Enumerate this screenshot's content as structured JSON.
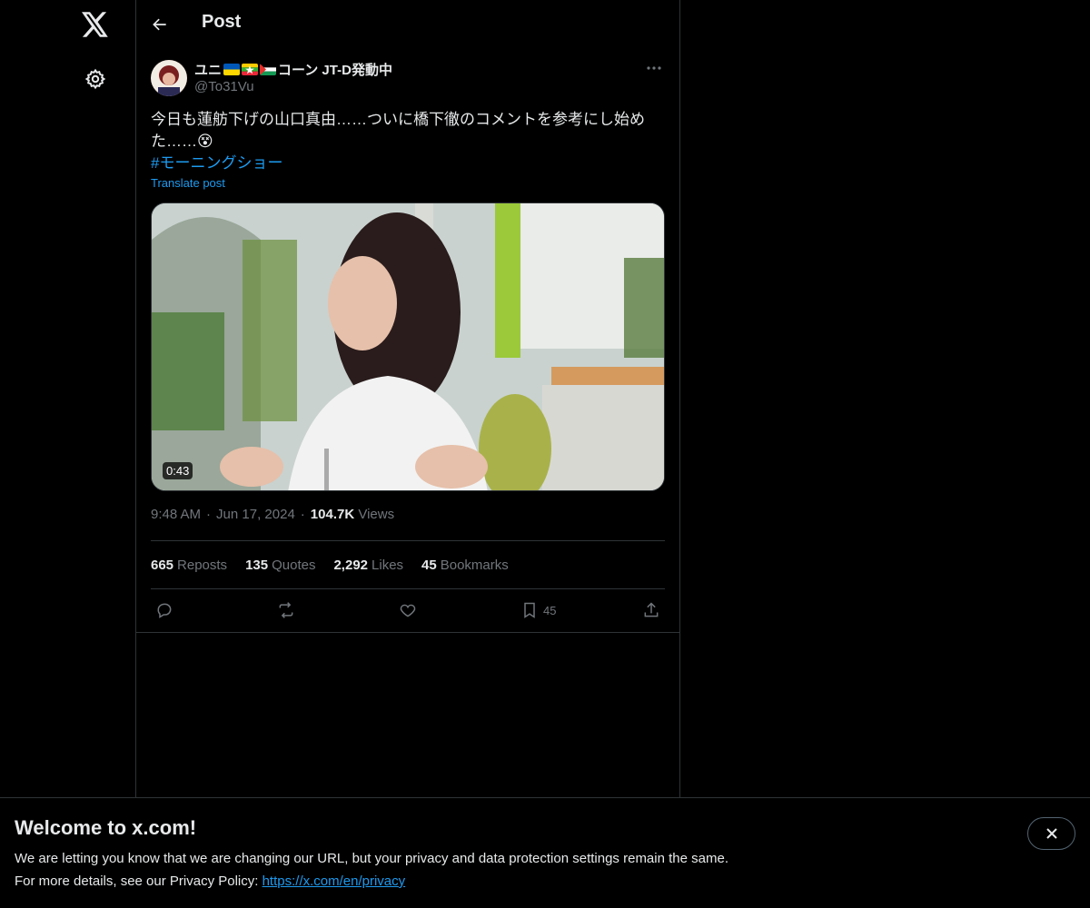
{
  "header": {
    "title": "Post"
  },
  "post": {
    "author": {
      "name_prefix": "ユニ",
      "name_suffix": "コーン JT-D発動中",
      "handle": "@To31Vu"
    },
    "text": "今日も蓮舫下げの山口真由……ついに橋下徹のコメントを参考にし始めた……",
    "emoji": "😵",
    "hashtag": "#モーニングショー",
    "translate_label": "Translate post",
    "video_duration": "0:43",
    "time": "9:48 AM",
    "date": "Jun 17, 2024",
    "views_count": "104.7K",
    "views_label": "Views",
    "separator": "·"
  },
  "stats": {
    "reposts_count": "665",
    "reposts_label": "Reposts",
    "quotes_count": "135",
    "quotes_label": "Quotes",
    "likes_count": "2,292",
    "likes_label": "Likes",
    "bookmarks_count": "45",
    "bookmarks_label": "Bookmarks"
  },
  "actions": {
    "bookmark_count": "45"
  },
  "banner": {
    "title": "Welcome to x.com!",
    "line1": "We are letting you know that we are changing our URL, but your privacy and data protection settings remain the same.",
    "line2_prefix": "For more details, see our Privacy Policy: ",
    "link_text": "https://x.com/en/privacy"
  },
  "colors": {
    "accent": "#1d9bf0",
    "text": "#e7e9ea",
    "muted": "#71767b",
    "border": "#2f3336"
  }
}
